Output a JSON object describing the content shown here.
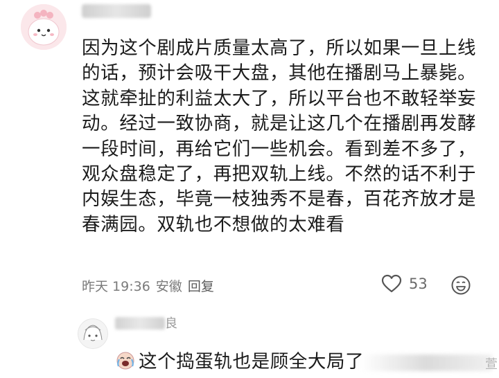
{
  "comment": {
    "text": "因为这个剧成片质量太高了，所以如果一旦上线的话，预计会吸干大盘，其他在播剧马上暴毙。这就牵扯的利益太大了，所以平台也不敢轻举妄动。经过一致协商，就是让这几个在播剧再发酵一段时间，再给它们一些机会。看到差不多了，观众盘稳定了，再把双轨上线。不然的话不利于内娱生态，毕竟一枝独秀不是春，百花齐放才是春满园。双轨也不想做的太难看",
    "time": "昨天 19:36",
    "location": "安徽",
    "reply_label": "回复",
    "like_count": "53",
    "icons": {
      "like": "heart-outline-icon",
      "emoji": "smiley-face-icon"
    }
  },
  "reply": {
    "name_tail": "良",
    "text": "这个捣蛋轨也是顾全大局了",
    "emoji": "crying-laughing-emoji"
  },
  "watermark": {
    "char": "萱"
  },
  "colors": {
    "text": "#1b1b1b",
    "meta": "#7a7a7a",
    "avatar_bg": "#fbe7ea"
  }
}
